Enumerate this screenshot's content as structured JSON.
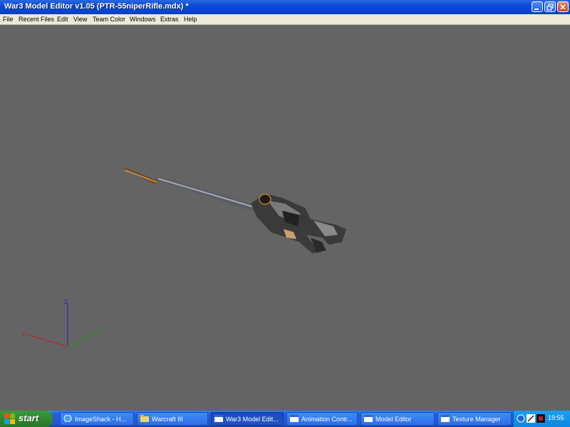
{
  "window": {
    "title": "War3 Model Editor v1.05 (PTR-55niperRifle.mdx) *"
  },
  "menu": {
    "items": [
      "File",
      "Recent Files",
      "Edit",
      "View",
      "Team Color",
      "Windows",
      "Extras",
      "Help"
    ]
  },
  "viewport": {
    "background_color": "#646464",
    "axes": {
      "z_label": "Z",
      "x_label": "X",
      "y_label": "Y"
    }
  },
  "taskbar": {
    "start_label": "start",
    "tasks": [
      {
        "label": "ImageShack - H...",
        "icon": "browser-icon"
      },
      {
        "label": "Warcraft III",
        "icon": "folder-icon"
      },
      {
        "label": "War3 Model Edit...",
        "icon": "window-icon",
        "active": true
      },
      {
        "label": "Animation Contr...",
        "icon": "window-icon"
      },
      {
        "label": "Model Editor",
        "icon": "window-icon"
      },
      {
        "label": "Texture Manager",
        "icon": "window-icon"
      }
    ],
    "clock": "19:55"
  }
}
